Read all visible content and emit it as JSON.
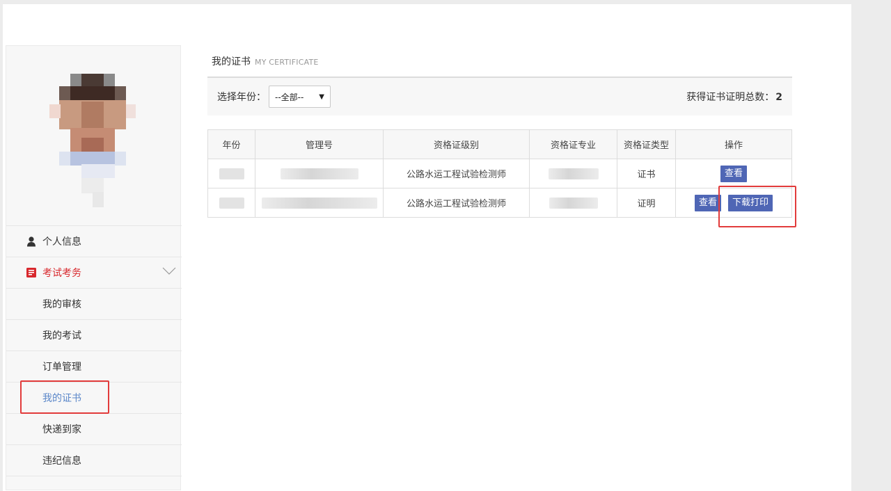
{
  "sidebar": {
    "menu": [
      {
        "label": "个人信息",
        "icon": "person-icon"
      },
      {
        "label": "考试考务",
        "icon": "exam-icon",
        "expanded": true
      },
      {
        "label": "我的审核"
      },
      {
        "label": "我的考试"
      },
      {
        "label": "订单管理"
      },
      {
        "label": "我的证书",
        "current": true
      },
      {
        "label": "快递到家"
      },
      {
        "label": "违纪信息"
      }
    ]
  },
  "content": {
    "title_cn": "我的证书",
    "title_en": "MY CERTIFICATE",
    "filter": {
      "label": "选择年份：",
      "selected": "--全部--"
    },
    "total": {
      "label": "获得证书证明总数：",
      "value": "2"
    },
    "table": {
      "headers": [
        "年份",
        "管理号",
        "资格证级别",
        "资格证专业",
        "资格证类型",
        "操作"
      ],
      "rows": [
        {
          "level": "公路水运工程试验检测师",
          "type": "证书",
          "actions": [
            "查看"
          ]
        },
        {
          "level": "公路水运工程试验检测师",
          "type": "证明",
          "actions": [
            "查看",
            "下载打印"
          ]
        }
      ]
    }
  },
  "colors": {
    "accent_blue": "#4f66b5",
    "active_red": "#d8282d",
    "current_blue": "#5b87c9",
    "highlight_red": "#e23b3b"
  }
}
